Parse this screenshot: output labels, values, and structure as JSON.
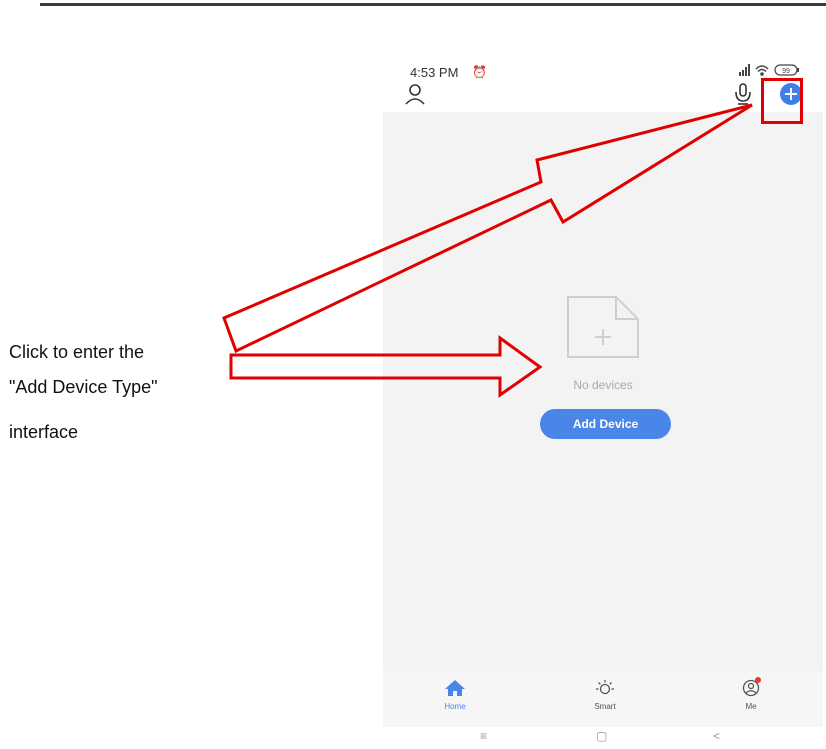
{
  "status_bar": {
    "time": "4:53 PM",
    "alarm_icon": "alarm-clock-icon",
    "signal_icon": "signal-icon",
    "wifi_icon": "wifi-icon",
    "battery_level": "99"
  },
  "header": {
    "profile_icon": "person-icon",
    "mic_icon": "microphone-icon",
    "add_icon": "plus-circle-icon"
  },
  "main": {
    "empty_icon": "add-file-icon",
    "empty_text": "No devices",
    "add_button": "Add Device"
  },
  "tabs": [
    {
      "label": "Home",
      "icon": "home-icon",
      "active": true
    },
    {
      "label": "Smart",
      "icon": "sun-icon",
      "active": false
    },
    {
      "label": "Me",
      "icon": "profile-icon",
      "active": false,
      "badge": true
    }
  ],
  "system_nav": [
    "≡",
    "▢",
    "<"
  ],
  "annotation": {
    "lines": [
      "Click to enter the",
      "\"Add Device Type\"",
      "interface"
    ],
    "highlight_color": "#e00000"
  }
}
